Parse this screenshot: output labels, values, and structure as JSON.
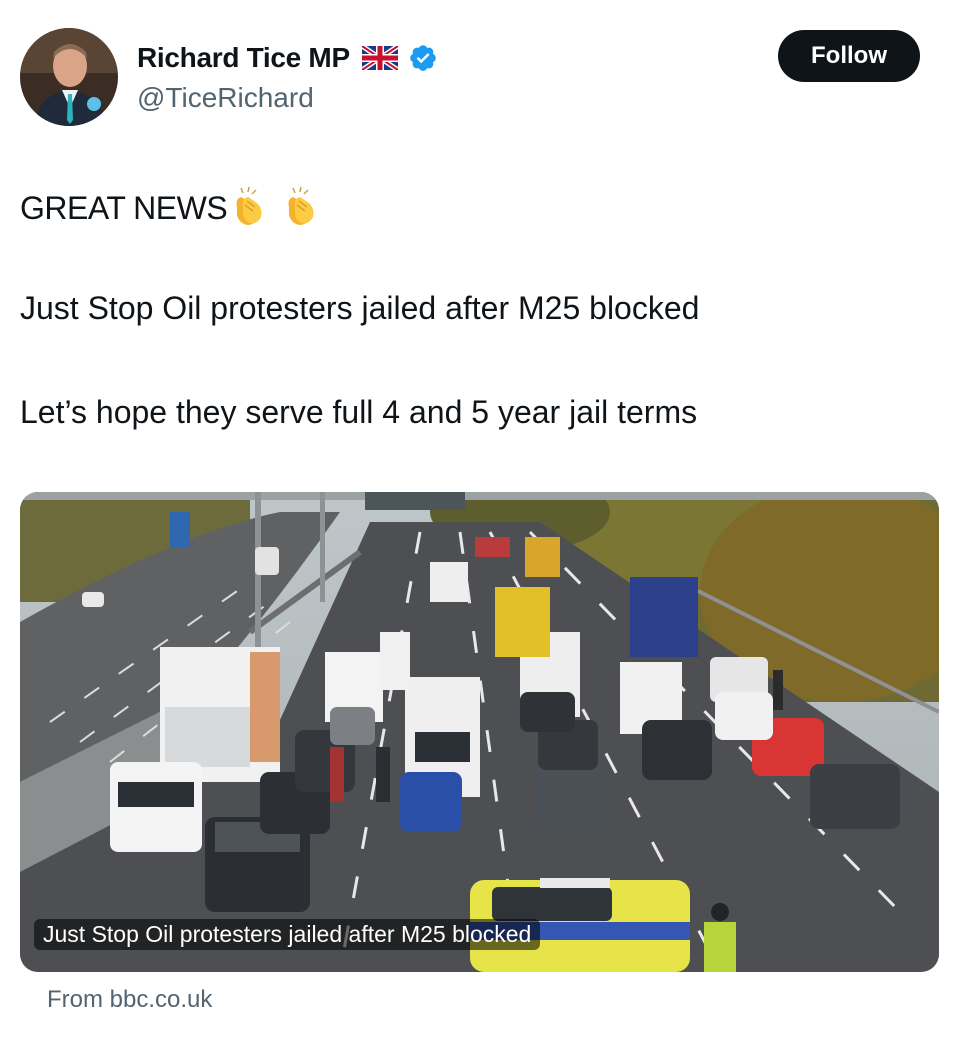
{
  "author": {
    "display_name": "Richard Tice MP",
    "handle": "@TiceRichard",
    "flag_icon": "union-jack-flag-icon",
    "verified_icon": "verified-badge-icon",
    "verified_color": "#1d9bf0"
  },
  "actions": {
    "follow_label": "Follow"
  },
  "tweet": {
    "line1": "GREAT NEWS",
    "line1_emoji": "clapping-hands-icon",
    "line2": "Just Stop Oil protesters jailed after M25 blocked",
    "line3": "Let’s hope they serve full 4 and 5 year jail terms"
  },
  "card": {
    "caption": "Just Stop Oil protesters jailed after M25 blocked",
    "source": "From bbc.co.uk"
  }
}
